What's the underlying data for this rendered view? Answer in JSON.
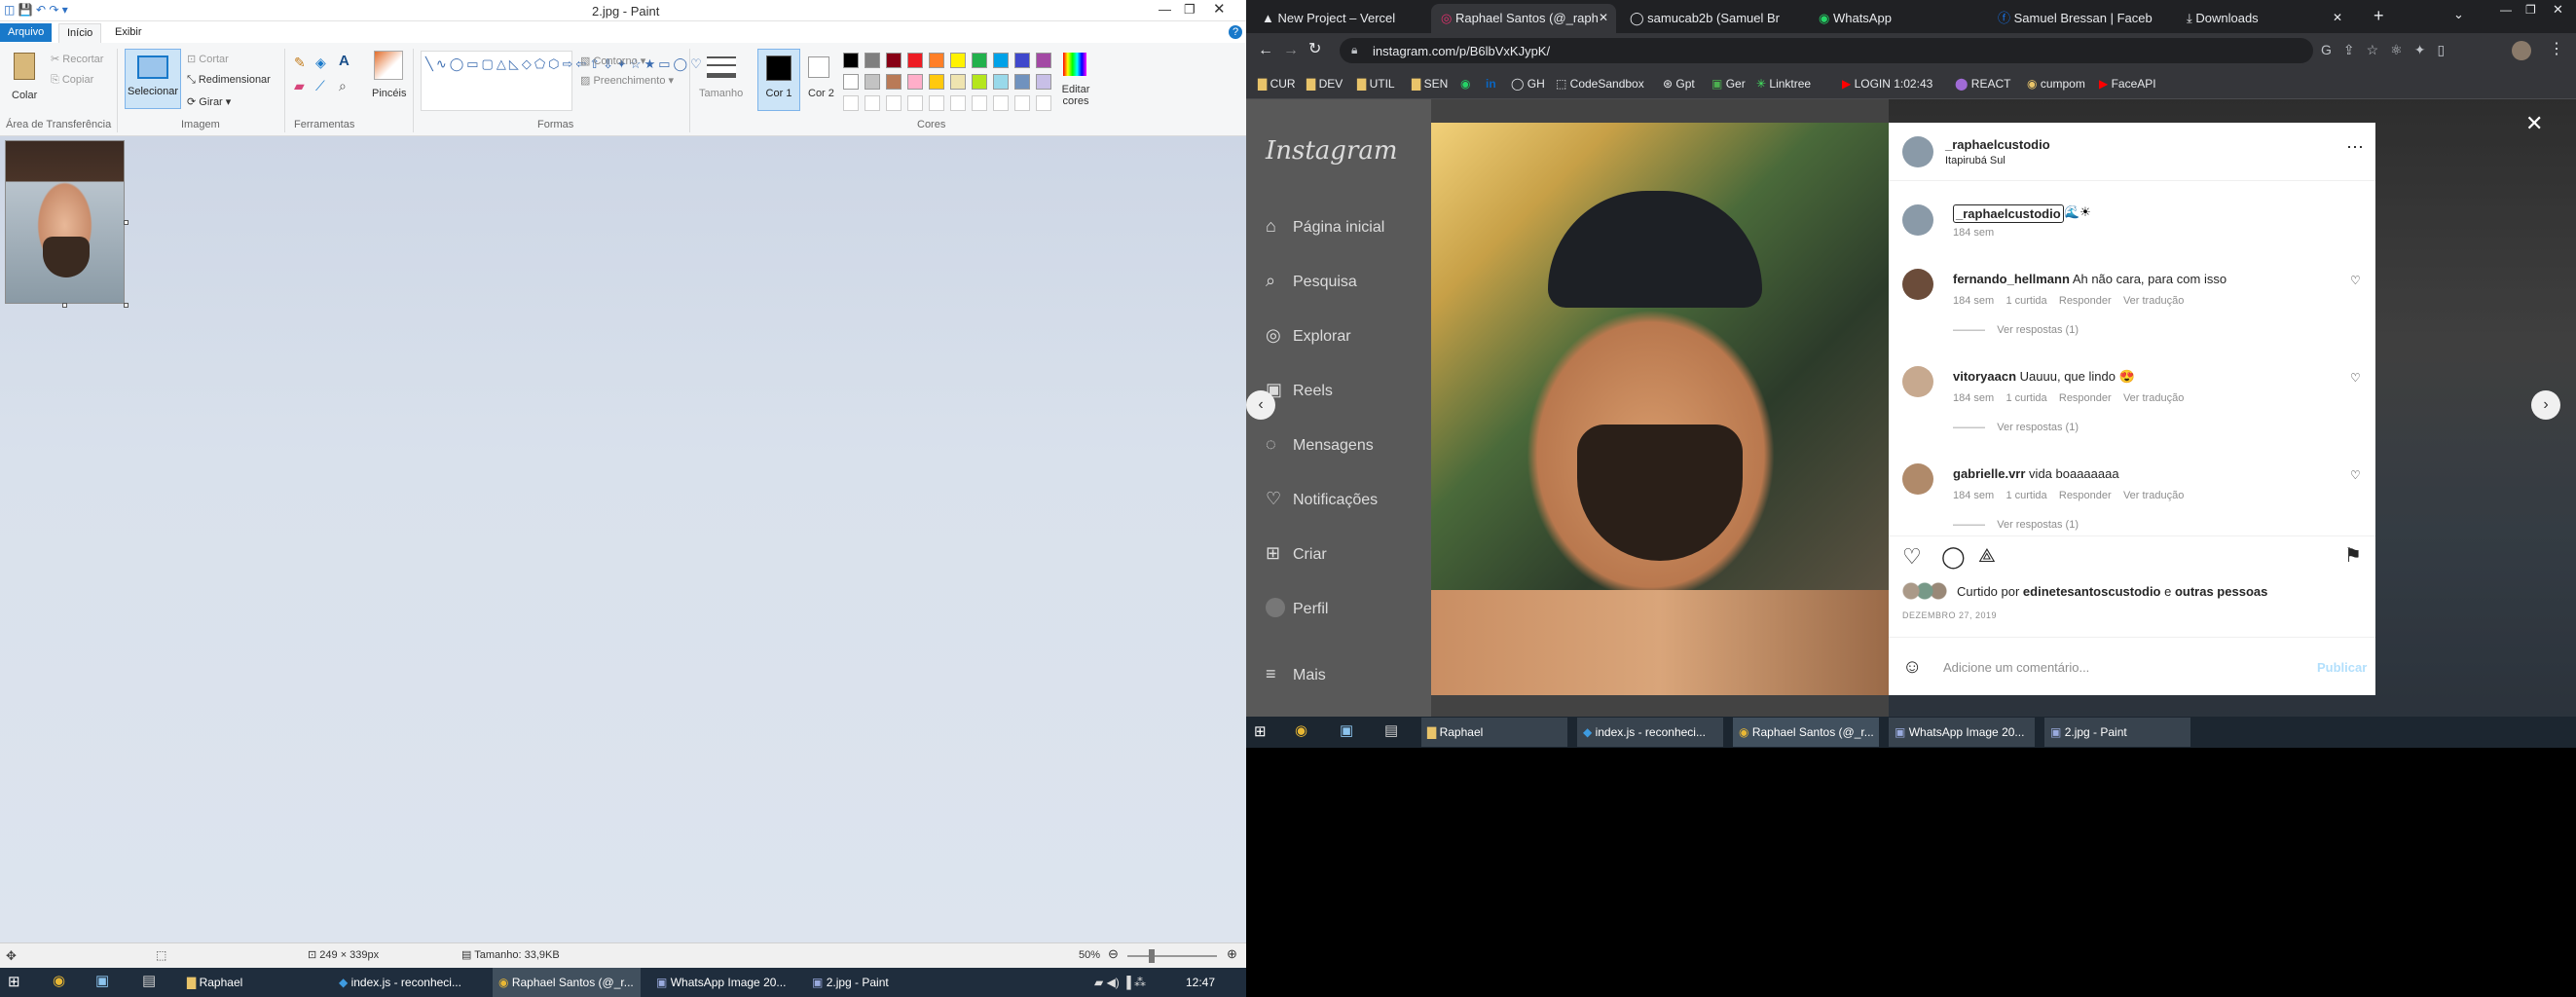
{
  "paint": {
    "title": "2.jpg - Paint",
    "tabs": {
      "file": "Arquivo",
      "home": "Início",
      "view": "Exibir"
    },
    "clipboard": {
      "paste": "Colar",
      "cut": "Recortar",
      "copy": "Copiar",
      "group": "Área de Transferência"
    },
    "image": {
      "select": "Selecionar",
      "crop": "Cortar",
      "resize": "Redimensionar",
      "rotate": "Girar",
      "group": "Imagem"
    },
    "tools_group": "Ferramentas",
    "brushes": "Pincéis",
    "shapes": {
      "outline": "Contorno",
      "fill": "Preenchimento",
      "group": "Formas"
    },
    "size": "Tamanho",
    "color1": "Cor 1",
    "color2": "Cor 2",
    "colors_group": "Cores",
    "edit_colors": "Editar cores",
    "palette": [
      "#000000",
      "#7f7f7f",
      "#880015",
      "#ed1c24",
      "#ff7f27",
      "#fff200",
      "#22b14c",
      "#00a2e8",
      "#3f48cc",
      "#a349a4",
      "#ffffff",
      "#c3c3c3",
      "#b97a57",
      "#ffaec9",
      "#ffc90e",
      "#efe4b0",
      "#b5e61d",
      "#99d9ea",
      "#7092be",
      "#c8bfe7"
    ],
    "status": {
      "dimensions": "249 × 339px",
      "size": "Tamanho: 33,9KB",
      "zoom": "50%"
    },
    "taskbar": {
      "items": [
        "Raphael",
        "index.js - reconheci...",
        "Raphael Santos (@_r...",
        "WhatsApp Image 20...",
        "2.jpg - Paint"
      ],
      "time": "12:47"
    }
  },
  "chrome": {
    "tabs": [
      "New Project – Vercel",
      "Raphael Santos (@_raph",
      "samucab2b (Samuel Br",
      "WhatsApp",
      "Samuel Bressan | Faceb",
      "Downloads"
    ],
    "url": "instagram.com/p/B6lbVxKJypK/",
    "bookmarks": [
      "CUR",
      "DEV",
      "UTIL",
      "SEN",
      "GH",
      "CodeSandbox",
      "Gpt",
      "Ger",
      "Linktree",
      "LOGIN 1:02:43",
      "REACT",
      "cumpom",
      "FaceAPI"
    ]
  },
  "instagram": {
    "logo": "Instagram",
    "nav": [
      "Página inicial",
      "Pesquisa",
      "Explorar",
      "Reels",
      "Mensagens",
      "Notificações",
      "Criar",
      "Perfil",
      "Mais"
    ],
    "post": {
      "username": "_raphaelcustodio",
      "location": "Itapirubá Sul",
      "caption_user": "_raphaelcustodio",
      "caption_emoji": "🌊☀",
      "caption_time": "184 sem",
      "likes_prefix": "Curtido por ",
      "likes_user": "edinetesantoscustodio",
      "likes_mid": " e ",
      "likes_suffix": "outras pessoas",
      "date": "DEZEMBRO 27, 2019",
      "add_comment": "Adicione um comentário...",
      "publish": "Publicar"
    },
    "comments": [
      {
        "user": "fernando_hellmann",
        "text": " Ah não cara, para com isso",
        "time": "184 sem",
        "likes": "1 curtida",
        "reply": "Responder",
        "translate": "Ver tradução",
        "replies": "Ver respostas (1)"
      },
      {
        "user": "vitoryaacn",
        "text": " Uauuu, que lindo 😍",
        "time": "184 sem",
        "likes": "1 curtida",
        "reply": "Responder",
        "translate": "Ver tradução",
        "replies": "Ver respostas (1)"
      },
      {
        "user": "gabrielle.vrr",
        "text": " vida boaaaaaaa",
        "time": "184 sem",
        "likes": "1 curtida",
        "reply": "Responder",
        "translate": "Ver tradução",
        "replies": "Ver respostas (1)"
      }
    ]
  },
  "win_taskbar": {
    "items": [
      "Raphael",
      "index.js - reconheci...",
      "Raphael Santos (@_r...",
      "WhatsApp Image 20...",
      "2.jpg - Paint"
    ]
  }
}
